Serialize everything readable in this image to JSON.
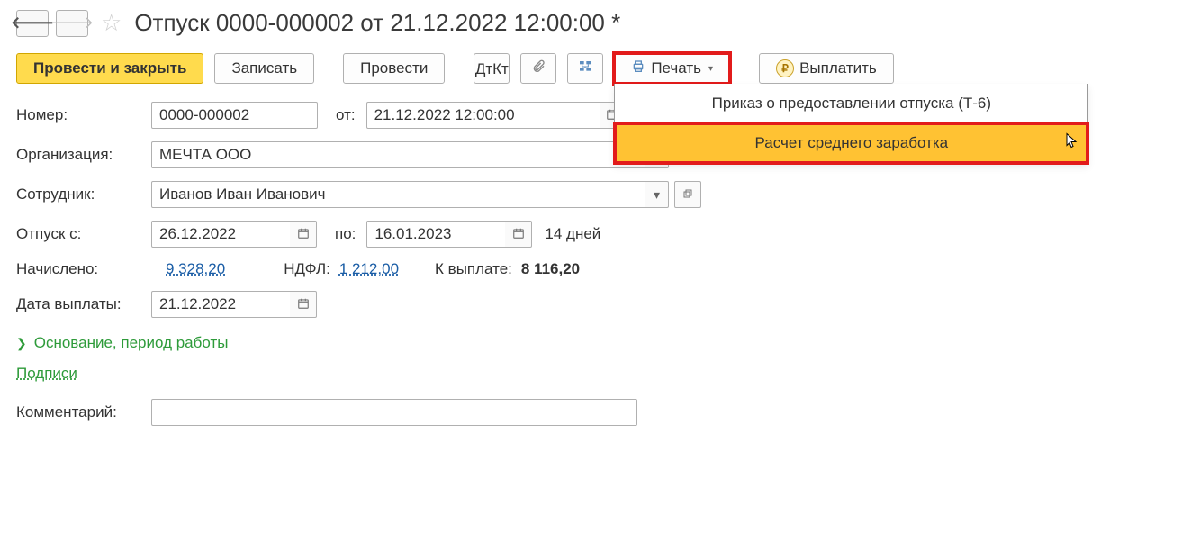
{
  "title": "Отпуск 0000-000002 от 21.12.2022 12:00:00 *",
  "toolbar": {
    "post_close": "Провести и закрыть",
    "save": "Записать",
    "post": "Провести",
    "print": "Печать",
    "pay": "Выплатить"
  },
  "print_menu": {
    "item1": "Приказ о предоставлении отпуска (Т-6)",
    "item2": "Расчет среднего заработка"
  },
  "form": {
    "number_label": "Номер:",
    "number": "0000-000002",
    "from_label": "от:",
    "datetime": "21.12.2022 12:00:00",
    "org_label": "Организация:",
    "org": "МЕЧТА ООО",
    "employee_label": "Сотрудник:",
    "employee": "Иванов Иван Иванович",
    "vacation_from_label": "Отпуск с:",
    "vacation_from": "26.12.2022",
    "to_label": "по:",
    "vacation_to": "16.01.2023",
    "days": "14 дней",
    "accrued_label": "Начислено:",
    "accrued": "9 328,20",
    "ndfl_label": "НДФЛ:",
    "ndfl": "1 212,00",
    "topay_label": "К выплате:",
    "topay": "8 116,20",
    "pay_date_label": "Дата выплаты:",
    "pay_date": "21.12.2022",
    "expander": "Основание, период работы",
    "signatures": "Подписи",
    "comment_label": "Комментарий:"
  }
}
